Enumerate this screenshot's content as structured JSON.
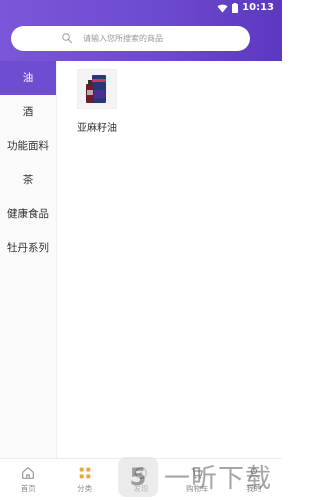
{
  "status_bar": {
    "time": "10:13",
    "icons": [
      "wifi-icon",
      "battery-icon"
    ]
  },
  "search": {
    "placeholder": "请输入您所搜索的商品",
    "icon": "search-icon"
  },
  "sidebar": {
    "items": [
      {
        "label": "油",
        "active": true
      },
      {
        "label": "酒",
        "active": false
      },
      {
        "label": "功能面料",
        "active": false
      },
      {
        "label": "茶",
        "active": false
      },
      {
        "label": "健康食品",
        "active": false
      },
      {
        "label": "牡丹系列",
        "active": false
      }
    ]
  },
  "products": [
    {
      "name": "亚麻籽油",
      "icon": "product-bottle-image"
    }
  ],
  "tabbar": {
    "items": [
      {
        "label": "首页",
        "icon": "home-icon"
      },
      {
        "label": "分类",
        "icon": "category-grid-icon"
      },
      {
        "label": "发现",
        "icon": "discover-icon"
      },
      {
        "label": "购物车",
        "icon": "cart-icon"
      },
      {
        "label": "我的",
        "icon": "profile-icon"
      }
    ]
  },
  "watermark": {
    "logo_text": "5",
    "text": "一听下载"
  },
  "colors": {
    "brand_purple": "#6e4dd0",
    "header_gradient_start": "#7a57d8",
    "header_gradient_end": "#5b38bf",
    "category_icon_orange": "#f2a33a"
  }
}
